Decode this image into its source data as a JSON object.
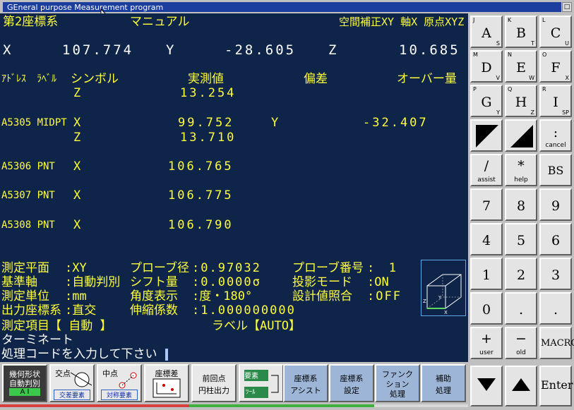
{
  "window": {
    "title": "GEneral purpose Measurement program",
    "control_glyph": "□"
  },
  "header": {
    "coord_system": "第2座標系",
    "mode": "マニュアル",
    "compensation": "空間補正XY 軸X 原点XYZ"
  },
  "position": {
    "x_label": "X",
    "x_value": "107.774",
    "y_label": "Y",
    "y_value": "-28.605",
    "z_label": "Z",
    "z_value": "10.685"
  },
  "columns": {
    "address": "ｱﾄﾞﾚｽ",
    "label": "ﾗﾍﾞﾙ",
    "symbol": "シンボル",
    "measured": "実測値",
    "deviation": "偏差",
    "over": "オーバー量"
  },
  "rows": [
    {
      "address": "",
      "symbol": "Z",
      "value": "13.254",
      "symbol2": "",
      "value2": ""
    },
    {
      "address": "A5305 MIDPT",
      "symbol": "X",
      "value": "99.752",
      "symbol2": "Y",
      "value2": "-32.407"
    },
    {
      "address": "",
      "symbol": "Z",
      "value": "13.710",
      "symbol2": "",
      "value2": ""
    },
    {
      "address": "A5306 PNT",
      "symbol": "X",
      "value": "106.765",
      "symbol2": "",
      "value2": ""
    },
    {
      "address": "A5307 PNT",
      "symbol": "X",
      "value": "106.775",
      "symbol2": "",
      "value2": ""
    },
    {
      "address": "A5308 PNT",
      "symbol": "X",
      "value": "106.790",
      "symbol2": "",
      "value2": ""
    }
  ],
  "settings": {
    "plane_label": "測定平面",
    "plane_value": ":XY",
    "probe_dia_label": "プローブ径",
    "probe_dia_value": ":0.97032",
    "probe_no_label": "プローブ番号",
    "probe_no_value": ":  1",
    "ref_axis_label": "基準軸",
    "ref_axis_value": ":自動判別",
    "shift_label": "シフト量",
    "shift_value": ":0.0000σ",
    "proj_label": "投影モード",
    "proj_value": ":ON",
    "unit_label": "測定単位",
    "unit_value": ":mm",
    "angle_label": "角度表示",
    "angle_value": ":度・180°",
    "design_label": "設計値照合",
    "design_value": ":OFF",
    "out_label": "出力座標系",
    "out_value": ":直交",
    "scale_label": "伸縮係数",
    "scale_value": ":1.000000000",
    "item_label": "測定項目【 自動 】",
    "label_setting": "ラベル【AUTO】"
  },
  "console": {
    "line1": "ターミネート",
    "line2": "処理コードを入力して下さい"
  },
  "keypad": {
    "A": "A",
    "A_tl": "J",
    "A_br": "S",
    "B": "B",
    "B_tl": "K",
    "B_br": "T",
    "C": "C",
    "C_tl": "L",
    "C_br": "U",
    "D": "D",
    "D_tl": "M",
    "D_br": "V",
    "E": "E",
    "E_tl": "N",
    "E_br": "W",
    "F": "F",
    "F_tl": "O",
    "F_br": "X",
    "G": "G",
    "G_tl": "P",
    "G_br": "Y",
    "H": "H",
    "H_tl": "Q",
    "H_br": "Z",
    "I": "I",
    "I_tl": "R",
    "I_br": "SP",
    "colon": ":",
    "cancel": "cancel",
    "slash": "/",
    "assist": "assist",
    "star": "*",
    "help": "help",
    "bs": "BS",
    "n7": "7",
    "n8": "8",
    "n9": "9",
    "n4": "4",
    "n5": "5",
    "n6": "6",
    "n1": "1",
    "n2": "2",
    "n3": "3",
    "n0": "0",
    "dot1": ".",
    "dot2": ".",
    "plus": "+",
    "user": "user",
    "minus": "−",
    "old": "old",
    "macro": "MACRO",
    "enter": "Enter"
  },
  "funcbar": {
    "geo1": "幾何形状",
    "geo2": "自動判別",
    "geo3": "A I",
    "inter1": "交点",
    "inter2": "交差要素",
    "mid1": "中点",
    "mid2": "対称要素",
    "coord1": "座標差",
    "prev1": "前回点",
    "prev2": "円柱出力",
    "elem1": "要素",
    "elem2": "ﾂｰﾙ",
    "assist1": "座標系",
    "assist2": "アシスト",
    "setting1": "座標系",
    "setting2": "設定",
    "func1": "ファンク",
    "func2": "ション",
    "func3": "処理",
    "aux1": "補助",
    "aux2": "処理"
  }
}
